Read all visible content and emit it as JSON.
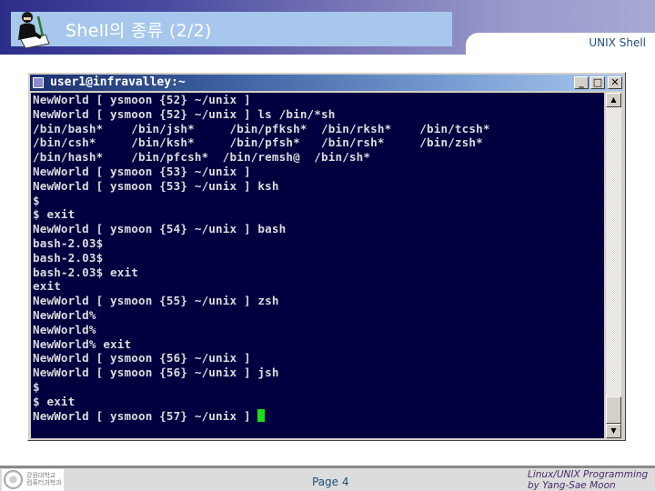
{
  "slide": {
    "title": "Shell의 종류 (2/2)",
    "section_label": "UNIX Shell",
    "page_label": "Page 4",
    "credit_line1": "Linux/UNIX Programming",
    "credit_line2": "by Yang-Sae Moon",
    "university_line1": "강원대학교",
    "university_line2": "컴퓨터과학과"
  },
  "window": {
    "title": "user1@infravalley:~",
    "buttons": {
      "minimize": "_",
      "maximize": "□",
      "close": "✕"
    },
    "scroll_up": "▲",
    "scroll_down": "▼"
  },
  "terminal": {
    "lines": [
      "NewWorld [ ysmoon {52} ~/unix ]",
      "NewWorld [ ysmoon {52} ~/unix ] ls /bin/*sh",
      "/bin/bash*    /bin/jsh*     /bin/pfksh*  /bin/rksh*    /bin/tcsh*",
      "/bin/csh*     /bin/ksh*     /bin/pfsh*   /bin/rsh*     /bin/zsh*",
      "/bin/hash*    /bin/pfcsh*  /bin/remsh@  /bin/sh*",
      "NewWorld [ ysmoon {53} ~/unix ]",
      "NewWorld [ ysmoon {53} ~/unix ] ksh",
      "$",
      "$ exit",
      "NewWorld [ ysmoon {54} ~/unix ] bash",
      "bash-2.03$",
      "bash-2.03$",
      "bash-2.03$ exit",
      "exit",
      "NewWorld [ ysmoon {55} ~/unix ] zsh",
      "NewWorld%",
      "NewWorld%",
      "NewWorld% exit",
      "NewWorld [ ysmoon {56} ~/unix ]",
      "NewWorld [ ysmoon {56} ~/unix ] jsh",
      "$",
      "$ exit",
      "NewWorld [ ysmoon {57} ~/unix ] "
    ]
  },
  "colors": {
    "terminal_bg": "#000040",
    "terminal_fg": "#dcdcdc",
    "cursor": "#19e019",
    "title_band": "#a7c8ec"
  }
}
